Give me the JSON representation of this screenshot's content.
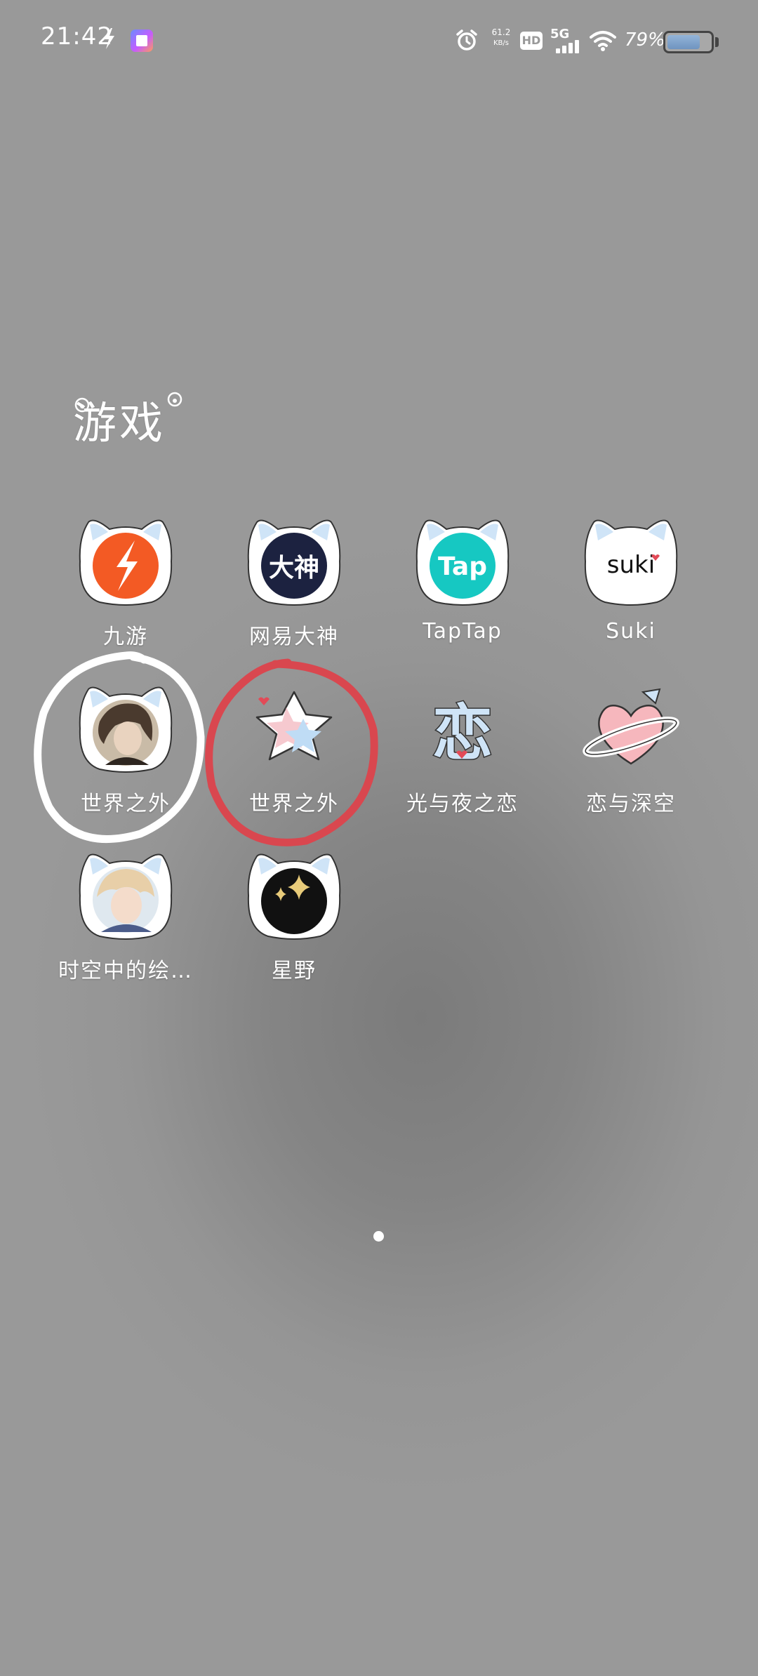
{
  "status_bar": {
    "time": "21:42",
    "net_speed_value": "61.2",
    "net_speed_unit": "KB/s",
    "hd_label": "HD",
    "network_type": "5G",
    "battery_percent_text": "79%",
    "battery_level": 0.79
  },
  "folder": {
    "title": "游戏"
  },
  "apps": [
    {
      "label": "九游",
      "icon": "jiuyou-logo-icon",
      "color": "#f35a24"
    },
    {
      "label": "网易大神",
      "icon": "dashen-logo-icon",
      "color": "#1c2240",
      "icon_text": "大神"
    },
    {
      "label": "TapTap",
      "icon": "taptap-logo-icon",
      "color": "#16c8c2",
      "icon_text": "Tap"
    },
    {
      "label": "Suki",
      "icon": "suki-logo-icon",
      "color": "#ffffff",
      "icon_text": "suki"
    },
    {
      "label": "世界之外",
      "icon": "portrait-icon",
      "color": "#6b5a4c"
    },
    {
      "label": "世界之外",
      "icon": "star-icon",
      "color": "#f6c9cf"
    },
    {
      "label": "光与夜之恋",
      "icon": "lian-character-icon",
      "color": "#cfe4f7",
      "icon_text": "恋"
    },
    {
      "label": "恋与深空",
      "icon": "planet-heart-icon",
      "color": "#f6b7bd"
    },
    {
      "label": "时空中的绘…",
      "icon": "anime-character-icon",
      "color": "#e8cfa8"
    },
    {
      "label": "星野",
      "icon": "sparkle-icon",
      "color": "#111111"
    }
  ],
  "annotations": {
    "white_circle_color": "#ffffff",
    "red_circle_color": "#d9474f"
  },
  "pager": {
    "current_page": 1
  }
}
